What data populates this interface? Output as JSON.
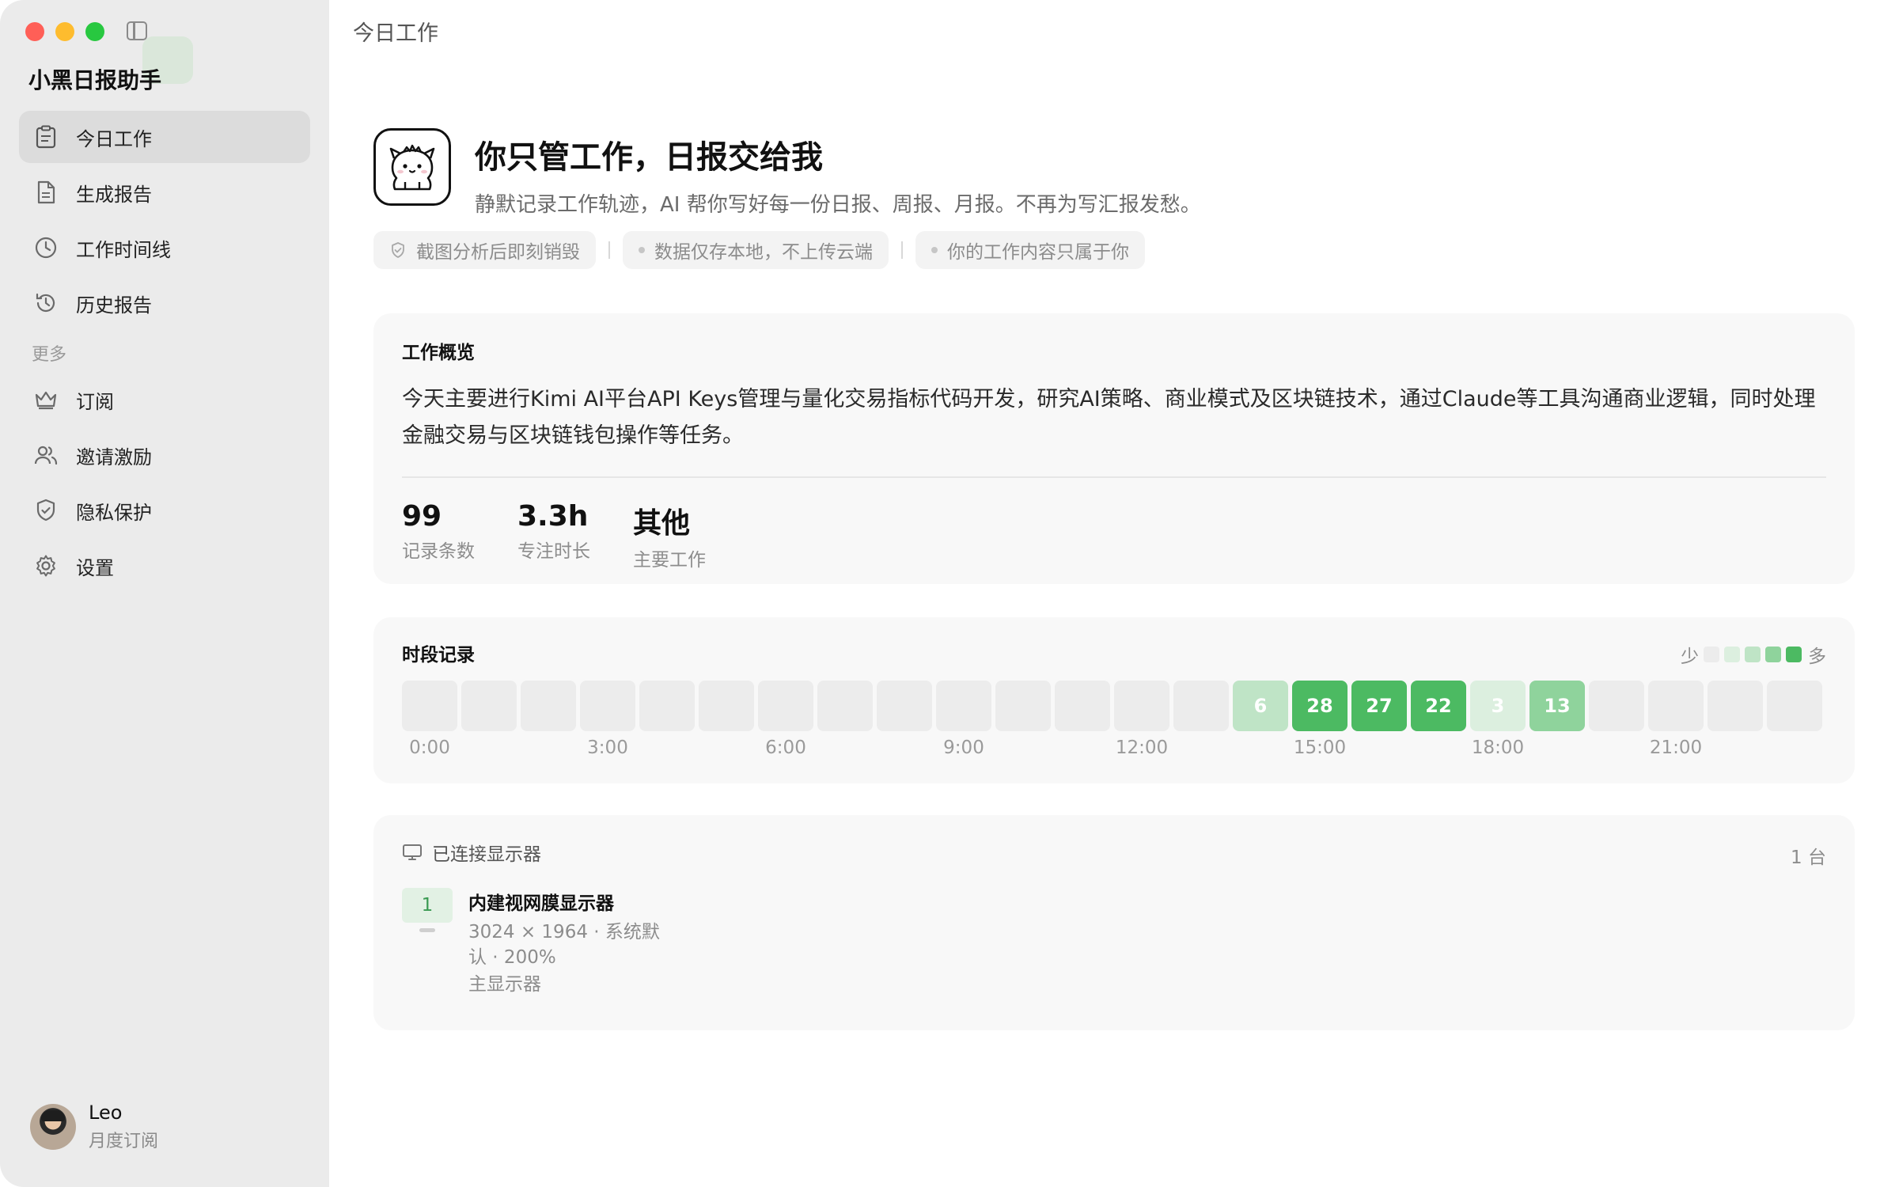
{
  "sidebar": {
    "app_name": "小黑日报助手",
    "items": [
      {
        "label": "今日工作",
        "icon": "clipboard-icon",
        "active": true
      },
      {
        "label": "生成报告",
        "icon": "document-icon"
      },
      {
        "label": "工作时间线",
        "icon": "clock-icon"
      },
      {
        "label": "历史报告",
        "icon": "history-icon"
      }
    ],
    "section_more": "更多",
    "more_items": [
      {
        "label": "订阅",
        "icon": "crown-icon"
      },
      {
        "label": "邀请激励",
        "icon": "users-icon"
      },
      {
        "label": "隐私保护",
        "icon": "shield-icon"
      },
      {
        "label": "设置",
        "icon": "gear-icon"
      }
    ],
    "user": {
      "name": "Leo",
      "plan": "月度订阅"
    }
  },
  "header": {
    "title": "今日工作"
  },
  "hero": {
    "title": "你只管工作，日报交给我",
    "subtitle": "静默记录工作轨迹，AI 帮你写好每一份日报、周报、月报。不再为写汇报发愁。",
    "tags": [
      "截图分析后即刻销毁",
      "数据仅存本地，不上传云端",
      "你的工作内容只属于你"
    ]
  },
  "overview": {
    "title": "工作概览",
    "text": "今天主要进行Kimi AI平台API Keys管理与量化交易指标代码开发，研究AI策略、商业模式及区块链技术，通过Claude等工具沟通商业逻辑，同时处理金融交易与区块链钱包操作等任务。",
    "stats": [
      {
        "value": "99",
        "label": "记录条数"
      },
      {
        "value": "3.3h",
        "label": "专注时长"
      },
      {
        "value": "其他",
        "label": "主要工作"
      }
    ]
  },
  "timeline": {
    "title": "时段记录",
    "legend_low": "少",
    "legend_high": "多",
    "legend_colors": [
      "#ececec",
      "#dcefdf",
      "#bfe4c6",
      "#8fd39c",
      "#4cba62"
    ],
    "hours": [
      {
        "hour": 0,
        "count": null
      },
      {
        "hour": 1,
        "count": null
      },
      {
        "hour": 2,
        "count": null
      },
      {
        "hour": 3,
        "count": null
      },
      {
        "hour": 4,
        "count": null
      },
      {
        "hour": 5,
        "count": null
      },
      {
        "hour": 6,
        "count": null
      },
      {
        "hour": 7,
        "count": null
      },
      {
        "hour": 8,
        "count": null
      },
      {
        "hour": 9,
        "count": null
      },
      {
        "hour": 10,
        "count": null
      },
      {
        "hour": 11,
        "count": null
      },
      {
        "hour": 12,
        "count": null
      },
      {
        "hour": 13,
        "count": null
      },
      {
        "hour": 14,
        "count": 6
      },
      {
        "hour": 15,
        "count": 28
      },
      {
        "hour": 16,
        "count": 27
      },
      {
        "hour": 17,
        "count": 22
      },
      {
        "hour": 18,
        "count": 3
      },
      {
        "hour": 19,
        "count": 13
      },
      {
        "hour": 20,
        "count": null
      },
      {
        "hour": 21,
        "count": null
      },
      {
        "hour": 22,
        "count": null
      },
      {
        "hour": 23,
        "count": null
      }
    ],
    "axis_labels": [
      {
        "hour": 0,
        "label": "0:00"
      },
      {
        "hour": 3,
        "label": "3:00"
      },
      {
        "hour": 6,
        "label": "6:00"
      },
      {
        "hour": 9,
        "label": "9:00"
      },
      {
        "hour": 12,
        "label": "12:00"
      },
      {
        "hour": 15,
        "label": "15:00"
      },
      {
        "hour": 18,
        "label": "18:00"
      },
      {
        "hour": 21,
        "label": "21:00"
      }
    ]
  },
  "displays": {
    "title": "已连接显示器",
    "count": "1 台",
    "items": [
      {
        "index": "1",
        "name": "内建视网膜显示器",
        "meta": "3024 × 1964 · 系统默认 · 200%",
        "role": "主显示器"
      }
    ]
  },
  "colors": {
    "accent": "#4cba62",
    "accent_light": "#dcefdf"
  }
}
